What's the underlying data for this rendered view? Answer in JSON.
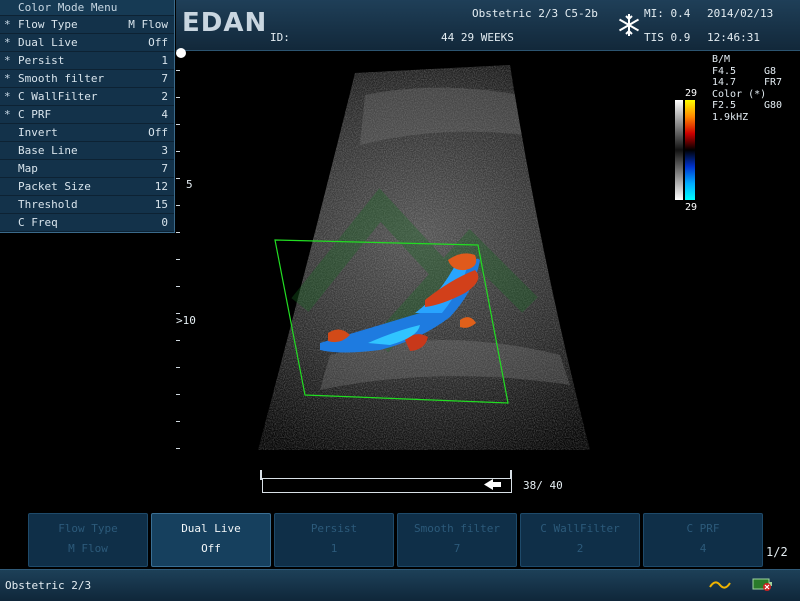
{
  "header": {
    "logo": "EDAN",
    "id_label": "ID:",
    "exam": "Obstetric 2/3 C5-2b",
    "gestation": "44 29 WEEKS",
    "mi": "MI: 0.4",
    "tis": "TIS 0.9",
    "date": "2014/02/13",
    "time": "12:46:31",
    "freeze_icon": "snowflake-icon"
  },
  "menu": {
    "title": "Color Mode Menu",
    "items": [
      {
        "star": "*",
        "label": "Flow Type",
        "value": "M Flow"
      },
      {
        "star": "*",
        "label": "Dual Live",
        "value": "Off"
      },
      {
        "star": "*",
        "label": "Persist",
        "value": "1"
      },
      {
        "star": "*",
        "label": "Smooth filter",
        "value": "7"
      },
      {
        "star": "*",
        "label": "C WallFilter",
        "value": "2"
      },
      {
        "star": "*",
        "label": "C PRF",
        "value": "4"
      },
      {
        "star": "",
        "label": "Invert",
        "value": "Off"
      },
      {
        "star": "",
        "label": "Base Line",
        "value": "3"
      },
      {
        "star": "",
        "label": "Map",
        "value": "7"
      },
      {
        "star": "",
        "label": "Packet Size",
        "value": "12"
      },
      {
        "star": "",
        "label": "Threshold",
        "value": "15"
      },
      {
        "star": "",
        "label": "C Freq",
        "value": "0"
      }
    ]
  },
  "depth_marks": {
    "d5": "5",
    "d10": ">10"
  },
  "params": {
    "bm_title": "B/M",
    "bm_rows": [
      {
        "a": "F4.5",
        "b": "G8"
      },
      {
        "a": "14.7",
        "b": "FR7"
      }
    ],
    "color_title": "Color (*)",
    "color_rows": [
      {
        "a": "F2.5",
        "b": "G80"
      },
      {
        "a": "1.9kHZ",
        "b": ""
      }
    ]
  },
  "color_bar": {
    "top": "29",
    "bottom": "29",
    "colors": [
      "#ffff00",
      "#ff8800",
      "#cc0000",
      "#000000",
      "#0033cc",
      "#00aaff",
      "#00ffff"
    ]
  },
  "cine": {
    "counter": "38/ 40",
    "arrow_icon": "rewind-arrow-icon"
  },
  "softkeys": [
    {
      "label": "Flow Type",
      "value": "M Flow",
      "active": false
    },
    {
      "label": "Dual Live",
      "value": "Off",
      "active": true
    },
    {
      "label": "Persist",
      "value": "1",
      "active": false
    },
    {
      "label": "Smooth filter",
      "value": "7",
      "active": false
    },
    {
      "label": "C WallFilter",
      "value": "2",
      "active": false
    },
    {
      "label": "C PRF",
      "value": "4",
      "active": false
    }
  ],
  "page_indicator": "1/2",
  "status": {
    "text": "Obstetric 2/3",
    "wave_icon": "wave-icon",
    "battery_icon": "battery-plug-icon"
  }
}
